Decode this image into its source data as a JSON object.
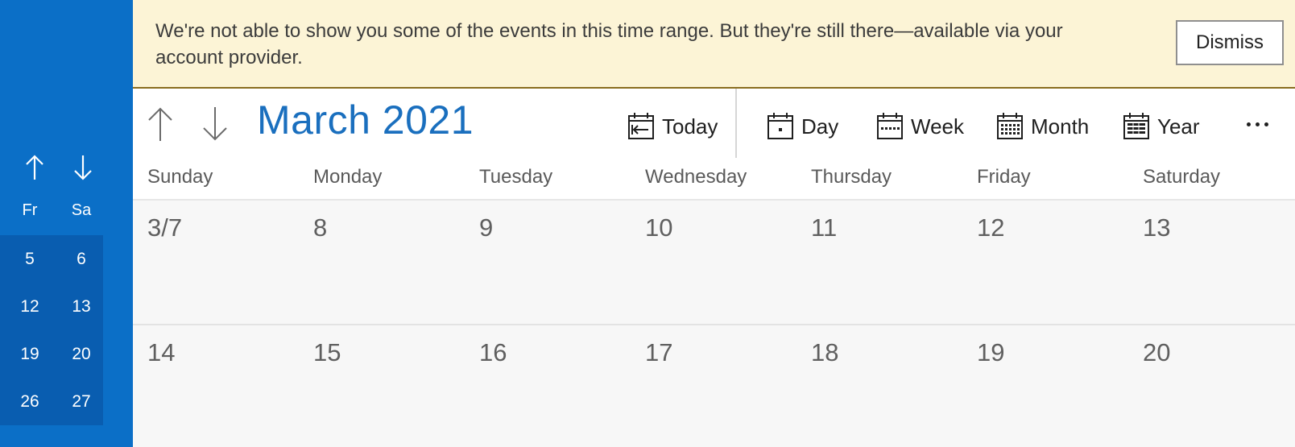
{
  "sidebar": {
    "up_icon": "arrow-up-icon",
    "down_icon": "arrow-down-icon",
    "day_headers": [
      "Fr",
      "Sa"
    ],
    "weeks": [
      [
        "5",
        "6"
      ],
      [
        "12",
        "13"
      ],
      [
        "19",
        "20"
      ],
      [
        "26",
        "27"
      ]
    ]
  },
  "banner": {
    "message": "We're not able to show you some of the events in this time range. But they're still there—available via your account provider.",
    "dismiss_label": "Dismiss"
  },
  "toolbar": {
    "title": "March 2021",
    "today_label": "Today",
    "day_label": "Day",
    "week_label": "Week",
    "month_label": "Month",
    "year_label": "Year"
  },
  "calendar": {
    "day_headers": [
      "Sunday",
      "Monday",
      "Tuesday",
      "Wednesday",
      "Thursday",
      "Friday",
      "Saturday"
    ],
    "weeks": [
      [
        "3/7",
        "8",
        "9",
        "10",
        "11",
        "12",
        "13"
      ],
      [
        "14",
        "15",
        "16",
        "17",
        "18",
        "19",
        "20"
      ]
    ]
  },
  "colors": {
    "sidebar_bg": "#0b6fc7",
    "sidebar_weeks_bg": "#095db0",
    "banner_bg": "#fcf4d6",
    "accent": "#1a6fbe",
    "grid_bg": "#f7f7f7"
  }
}
